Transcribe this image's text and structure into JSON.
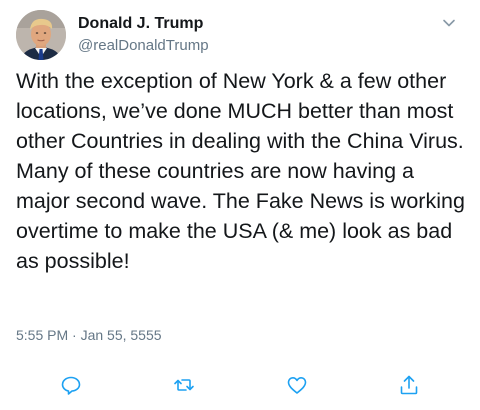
{
  "author": {
    "display_name": "Donald J. Trump",
    "handle": "@realDonaldTrump",
    "avatar": "profile-photo"
  },
  "tweet": {
    "text": "With the exception of New York & a few other locations, we’ve done MUCH better than most other Countries in dealing with the China Virus. Many of these countries are now having a major second wave. The Fake News is working overtime to make the USA (& me) look as bad as possible!",
    "timestamp": "5:55 PM · Jan 55, 5555"
  },
  "icons": {
    "menu": "chevron-down-icon",
    "reply": "reply-icon",
    "retweet": "retweet-icon",
    "like": "heart-icon",
    "share": "share-icon"
  },
  "colors": {
    "text": "#14171a",
    "secondary": "#657786",
    "icon": "#1da1f2"
  }
}
